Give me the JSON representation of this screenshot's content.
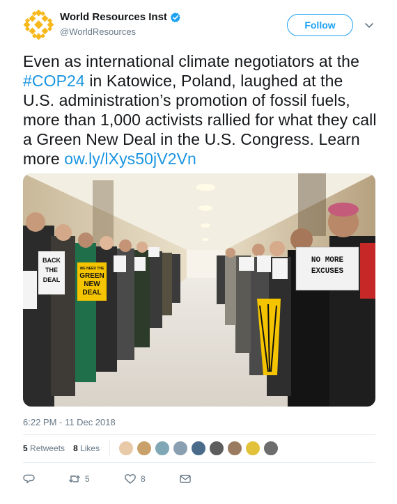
{
  "user": {
    "display_name": "World Resources Inst",
    "handle": "@WorldResources",
    "brand_color": "#f7b81c"
  },
  "follow_label": "Follow",
  "tweet": {
    "text_before": "Even as international climate negotiators at the ",
    "hashtag": "#COP24",
    "text_middle": " in Katowice, Poland, laughed at the U.S. administration’s promotion of fossil fuels, more than 1,000 activists rallied for what they call a Green New Deal in the U.S. Congress. Learn more ",
    "link": "ow.ly/lXys50jV2Vn"
  },
  "media": {
    "signs": {
      "no_more_excuses_line1": "NO MORE",
      "no_more_excuses_line2": "EXCUSES",
      "green_new_deal_line1": "WE NEED THE",
      "green_new_deal_line2": "GREEN",
      "green_new_deal_line3": "NEW",
      "green_new_deal_line4": "DEAL",
      "back_the_deal_line1": "BACK",
      "back_the_deal_line2": "THE",
      "back_the_deal_line3": "DEAL"
    }
  },
  "timestamp": "6:22 PM - 11 Dec 2018",
  "stats": {
    "retweets_count": "5",
    "retweets_label": "Retweets",
    "likes_count": "8",
    "likes_label": "Likes"
  },
  "likers": [
    "#e8c9a8",
    "#c9a06a",
    "#7fa7b5",
    "#8a9fb0",
    "#4a6a8a",
    "#5d5d5d",
    "#9b7b5f",
    "#e2c23a",
    "#6d6d6d"
  ],
  "actions": {
    "reply_icon": "reply-icon",
    "retweet_count": "5",
    "like_count": "8",
    "dm_icon": "envelope-icon"
  },
  "colors": {
    "link": "#1b95e0",
    "accent": "#1da1f2",
    "muted": "#657786"
  }
}
